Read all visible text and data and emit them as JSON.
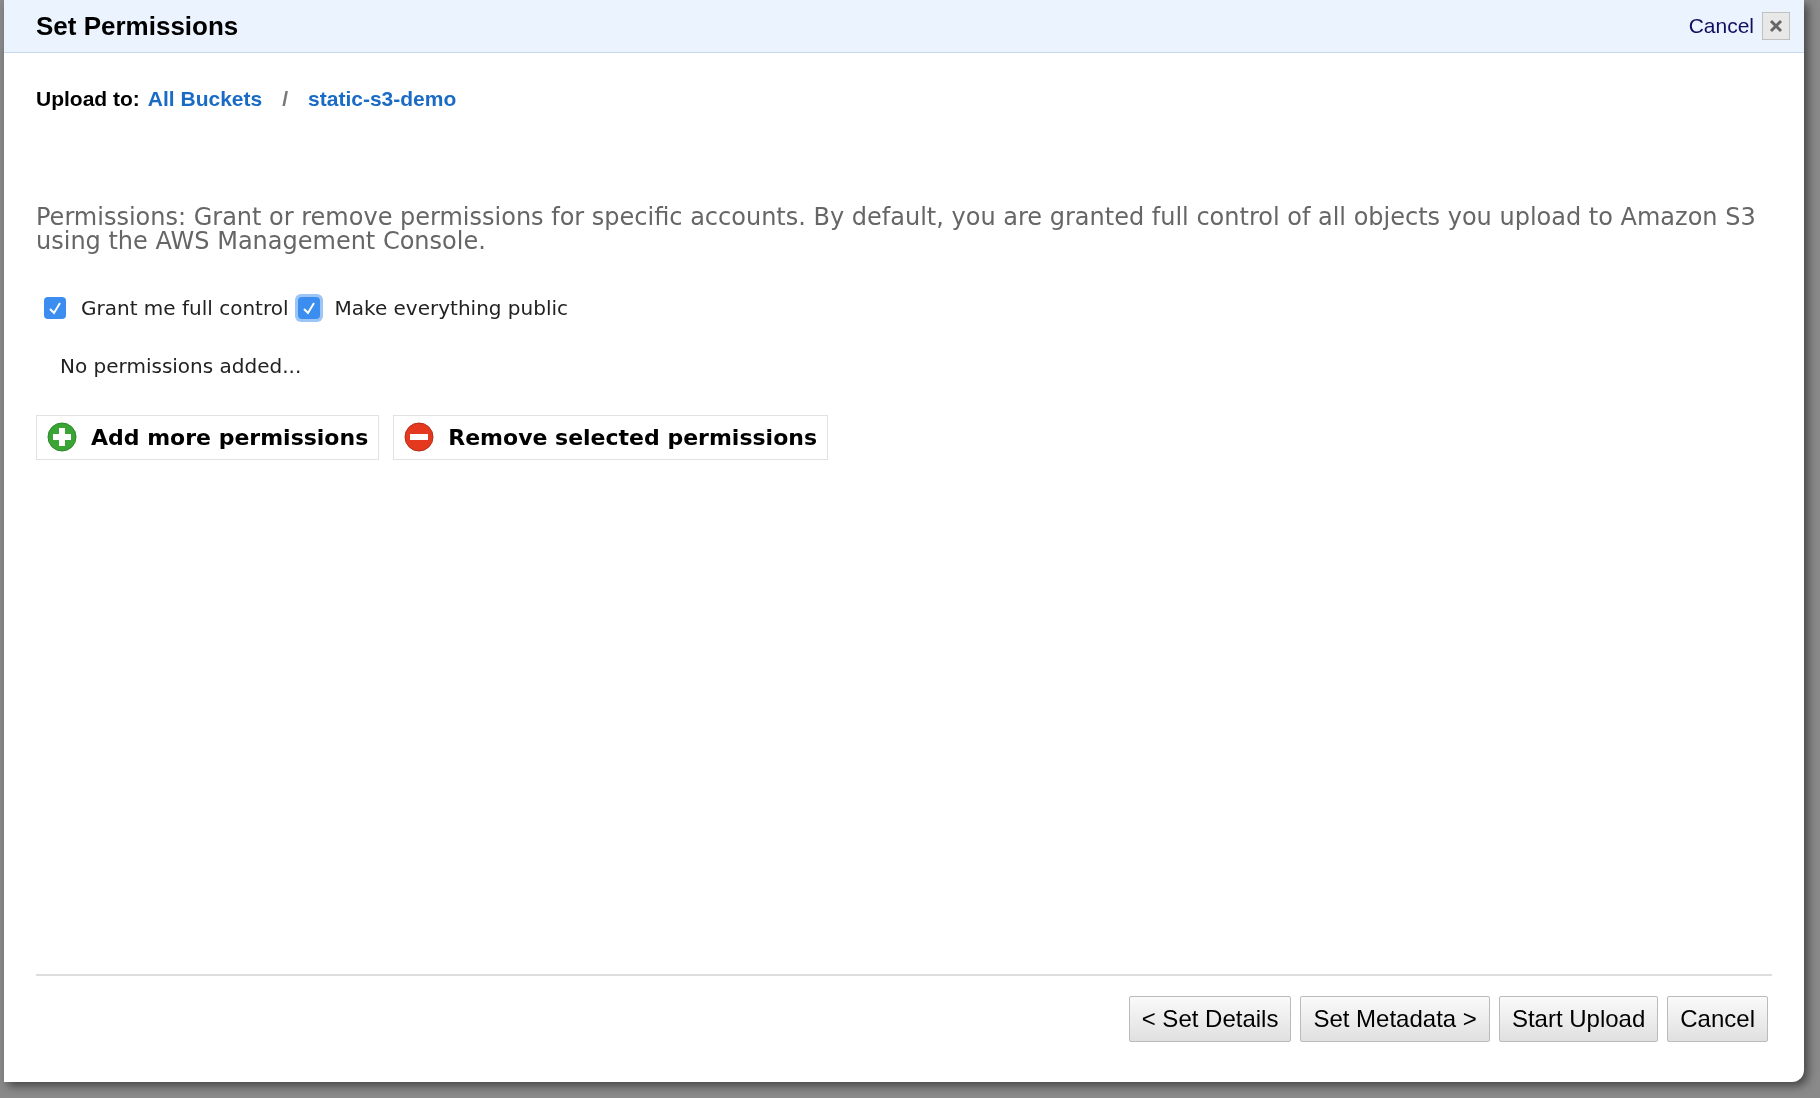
{
  "dialog": {
    "title": "Set Permissions",
    "cancel_link": "Cancel"
  },
  "breadcrumb": {
    "label": "Upload to:",
    "separator": "/",
    "items": [
      "All Buckets",
      "static-s3-demo"
    ]
  },
  "description": "Permissions: Grant or remove permissions for specific accounts. By default, you are granted full control of all objects you upload to Amazon S3 using the AWS Management Console.",
  "checkboxes": [
    {
      "label": "Grant me full control",
      "checked": true,
      "focused": false
    },
    {
      "label": "Make everything public",
      "checked": true,
      "focused": true
    }
  ],
  "empty_message": "No permissions added...",
  "actions": [
    {
      "kind": "add",
      "label": "Add more permissions"
    },
    {
      "kind": "remove",
      "label": "Remove selected permissions"
    }
  ],
  "footer_buttons": [
    "< Set Details",
    "Set Metadata >",
    "Start Upload",
    "Cancel"
  ]
}
